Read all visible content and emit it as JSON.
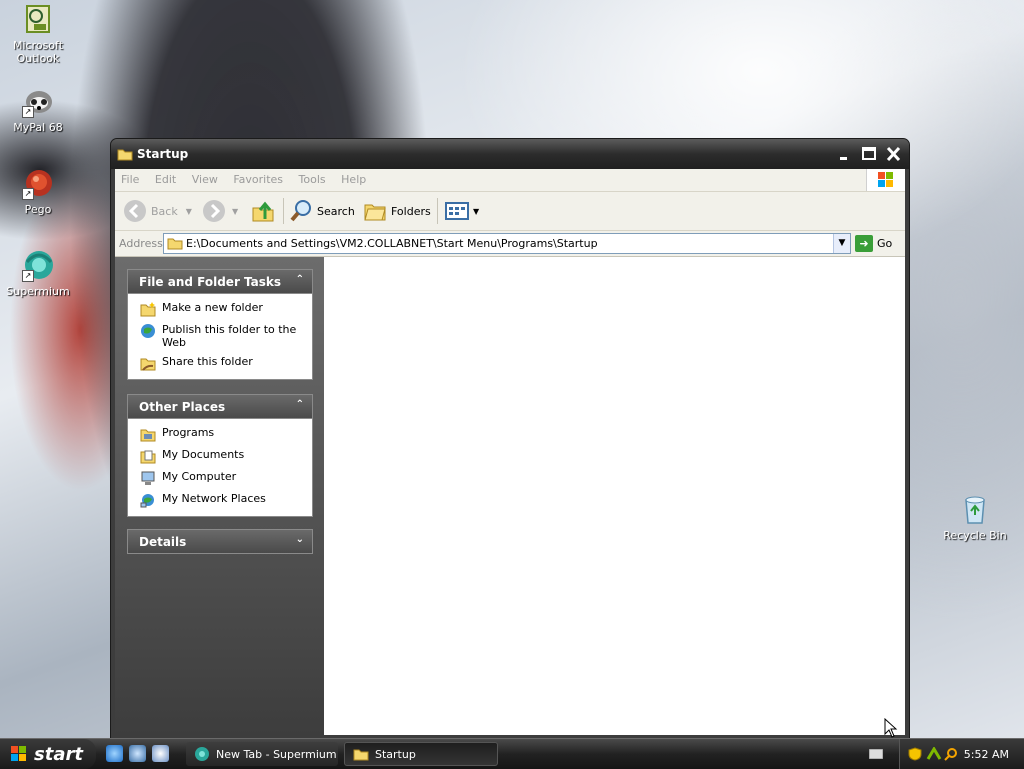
{
  "desktop": {
    "icons": [
      {
        "label": "Microsoft Outlook"
      },
      {
        "label": "MyPal 68"
      },
      {
        "label": "Pego"
      },
      {
        "label": "Supermium"
      },
      {
        "label": "Recycle Bin"
      }
    ]
  },
  "window": {
    "title": "Startup",
    "menu": [
      "File",
      "Edit",
      "View",
      "Favorites",
      "Tools",
      "Help"
    ],
    "toolbar": {
      "back_label": "Back",
      "search_label": "Search",
      "folders_label": "Folders"
    },
    "address": {
      "label": "Address",
      "value": "E:\\Documents and Settings\\VM2.COLLABNET\\Start Menu\\Programs\\Startup",
      "go_label": "Go"
    },
    "panels": [
      {
        "title": "File and Folder Tasks",
        "collapse_glyph": "⌃",
        "items": [
          "Make a new folder",
          "Publish this folder to the Web",
          "Share this folder"
        ]
      },
      {
        "title": "Other Places",
        "collapse_glyph": "⌃",
        "items": [
          "Programs",
          "My Documents",
          "My Computer",
          "My Network Places"
        ]
      },
      {
        "title": "Details",
        "collapse_glyph": "⌄",
        "items": []
      }
    ]
  },
  "taskbar": {
    "start_label": "start",
    "tasks": [
      "New Tab - Supermium",
      "Startup"
    ],
    "clock": "5:52 AM"
  },
  "colors": {
    "accent_green": "#3a9e38",
    "panel_bg": "#3d3d3d"
  }
}
